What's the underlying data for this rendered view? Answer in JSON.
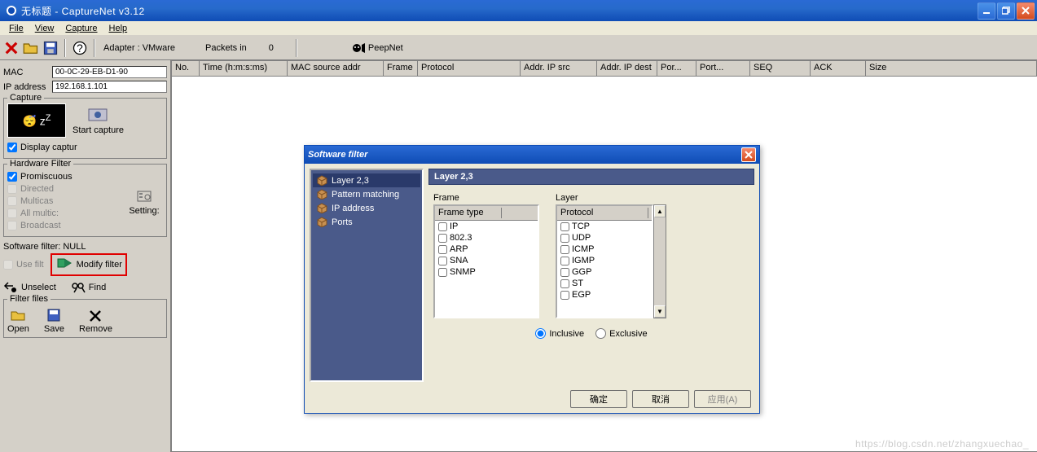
{
  "window": {
    "title": "无标题 - CaptureNet  v3.12"
  },
  "menu": {
    "file": "File",
    "view": "View",
    "capture": "Capture",
    "help": "Help"
  },
  "toolbar": {
    "adapter_label": "Adapter : VMware",
    "packets_label": "Packets in",
    "packets_value": "0",
    "peepnet": "PeepNet"
  },
  "sidebar": {
    "mac_label": "MAC",
    "mac_value": "00-0C-29-EB-D1-90",
    "ip_label": "IP address",
    "ip_value": "192.168.1.101",
    "capture_legend": "Capture",
    "start_capture": "Start capture",
    "display_capture": "Display captur",
    "hw_legend": "Hardware Filter",
    "hw_items": [
      "Promiscuous",
      "Directed",
      "Multicas",
      "All multic:",
      "Broadcast"
    ],
    "hw_settings": "Setting:",
    "sw_label": "Software filter: NULL",
    "use_filter": "Use filt",
    "modify_filter": "Modify filter",
    "unselect": "Unselect",
    "find": "Find",
    "ff_legend": "Filter files",
    "ff_items": [
      "Open",
      "Save",
      "Remove"
    ]
  },
  "columns": [
    "No.",
    "Time (h:m:s:ms)",
    "MAC source addr",
    "Frame",
    "Protocol",
    "Addr. IP src",
    "Addr. IP dest",
    "Por...",
    "Port...",
    "SEQ",
    "ACK",
    "Size"
  ],
  "dialog": {
    "title": "Software filter",
    "nav": [
      "Layer 2,3",
      "Pattern matching",
      "IP address",
      "Ports"
    ],
    "header": "Layer 2,3",
    "frame_label": "Frame",
    "frame_col": "Frame type",
    "frame_items": [
      "IP",
      "802.3",
      "ARP",
      "SNA",
      "SNMP"
    ],
    "layer_label": "Layer",
    "layer_col": "Protocol",
    "layer_items": [
      "TCP",
      "UDP",
      "ICMP",
      "IGMP",
      "GGP",
      "ST",
      "EGP"
    ],
    "inclusive": "Inclusive",
    "exclusive": "Exclusive",
    "ok": "确定",
    "cancel": "取消",
    "apply": "应用(A)"
  },
  "watermark": "https://blog.csdn.net/zhangxuechao_"
}
